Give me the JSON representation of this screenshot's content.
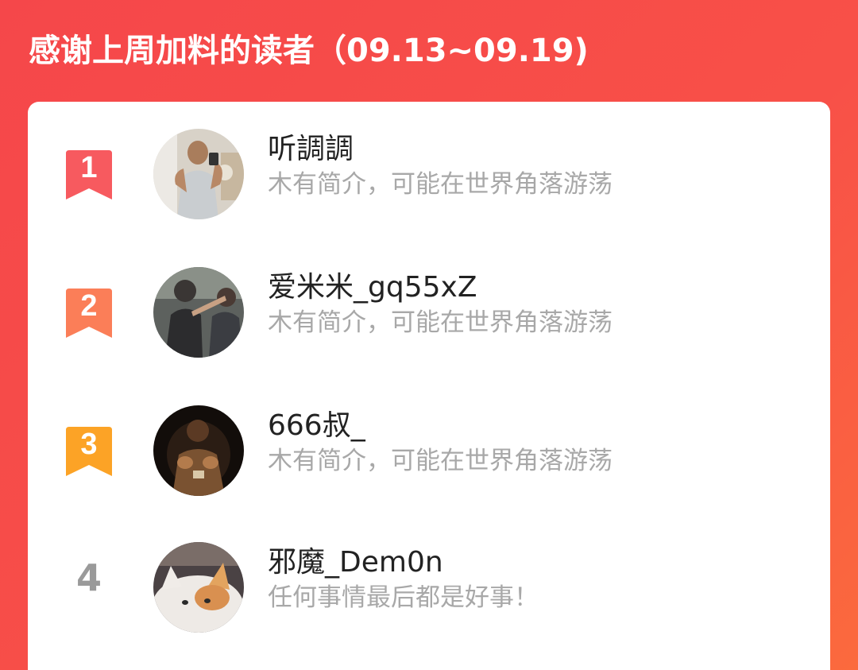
{
  "header": {
    "title": "感谢上周加料的读者（09.13~09.19)"
  },
  "colors": {
    "background_start": "#f5474a",
    "background_end": "#fb6a3d",
    "rank1": "#f75a5f",
    "rank2": "#fb7e58",
    "rank3": "#fca326",
    "rank_plain": "#9a9a9a"
  },
  "readers": [
    {
      "rank": "1",
      "name": "听調調",
      "bio": "木有简介，可能在世界角落游荡",
      "avatar_icon": "avatar-photo-man-gym"
    },
    {
      "rank": "2",
      "name": "爱米米_gq55xZ",
      "bio": "木有简介，可能在世界角落游荡",
      "avatar_icon": "avatar-photo-group"
    },
    {
      "rank": "3",
      "name": "666叔_",
      "bio": "木有简介，可能在世界角落游荡",
      "avatar_icon": "avatar-photo-dark-portrait"
    },
    {
      "rank": "4",
      "name": "邪魔_Dem0n",
      "bio": "任何事情最后都是好事！",
      "avatar_icon": "avatar-photo-cat"
    }
  ]
}
